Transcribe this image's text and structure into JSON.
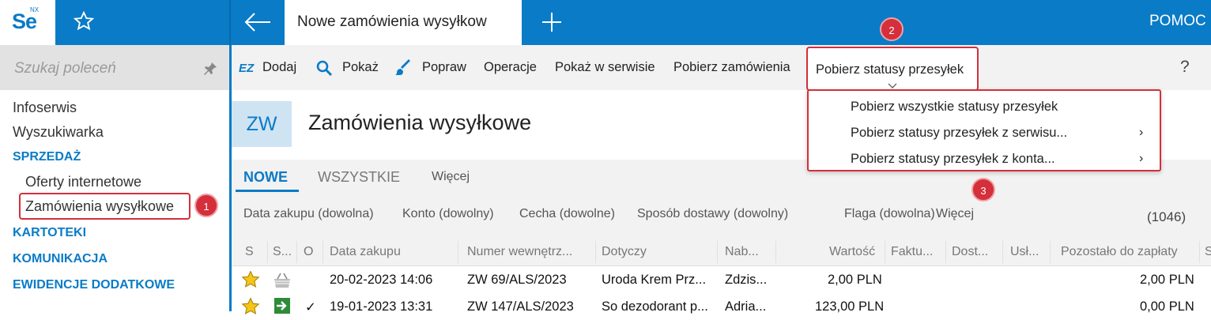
{
  "app": {
    "logo_text": "Se",
    "logo_sup": "NX",
    "active_tab": "Nowe zamówienia wysyłkow",
    "help_label": "POMOC"
  },
  "sidebar": {
    "search_placeholder": "Szukaj poleceń",
    "items": [
      {
        "label": "Infoserwis"
      },
      {
        "label": "Wyszukiwarka"
      }
    ],
    "sections": [
      {
        "label": "SPRZEDAŻ",
        "items": [
          "Oferty internetowe",
          "Zamówienia wysyłkowe"
        ]
      },
      {
        "label": "KARTOTEKI"
      },
      {
        "label": "KOMUNIKACJA"
      },
      {
        "label": "EWIDENCJE DODATKOWE"
      }
    ]
  },
  "toolbar": {
    "ez_label": "EZ",
    "add": "Dodaj",
    "show": "Pokaż",
    "edit": "Popraw",
    "operations": "Operacje",
    "show_in_service": "Pokaż w serwisie",
    "fetch_orders": "Pobierz zamówienia",
    "fetch_statuses": "Pobierz statusy przesyłek",
    "help": "?"
  },
  "dropdown": {
    "items": [
      "Pobierz wszystkie statusy przesyłek",
      "Pobierz statusy przesyłek z serwisu...",
      "Pobierz statusy przesyłek z konta..."
    ],
    "submenu_arrow": "›"
  },
  "header": {
    "badge": "ZW",
    "title": "Zamówienia wysyłkowe"
  },
  "tabs": [
    "NOWE",
    "WSZYSTKIE",
    "Więcej"
  ],
  "filters": {
    "items": [
      "Data zakupu (dowolna)",
      "Konto (dowolny)",
      "Cecha (dowolne)",
      "Sposób dostawy (dowolny)",
      "Flaga (dowolna)",
      "Więcej"
    ],
    "count": "(1046)"
  },
  "grid": {
    "columns": [
      "S",
      "S...",
      "O",
      "Data zakupu",
      "Numer wewnętrz...",
      "Dotyczy",
      "Nab...",
      "Wartość",
      "Faktu...",
      "Dost...",
      "Usł...",
      "Pozostało do zapłaty",
      "S"
    ],
    "rows": [
      {
        "date": "20-02-2023 14:06",
        "number": "ZW 69/ALS/2023",
        "concerns": "Uroda Krem Prz...",
        "buyer": "Zdzis...",
        "value": "2,00 PLN",
        "check": "",
        "remaining": "2,00 PLN"
      },
      {
        "date": "19-01-2023 13:31",
        "number": "ZW 147/ALS/2023",
        "concerns": "So dezodorant p...",
        "buyer": "Adria...",
        "value": "123,00 PLN",
        "check": "✓",
        "remaining": "0,00 PLN"
      }
    ]
  },
  "callouts": [
    "1",
    "2",
    "3"
  ],
  "colors": {
    "accent": "#0a7bc7",
    "callout": "#d42f3a",
    "star": "#f5c518"
  }
}
